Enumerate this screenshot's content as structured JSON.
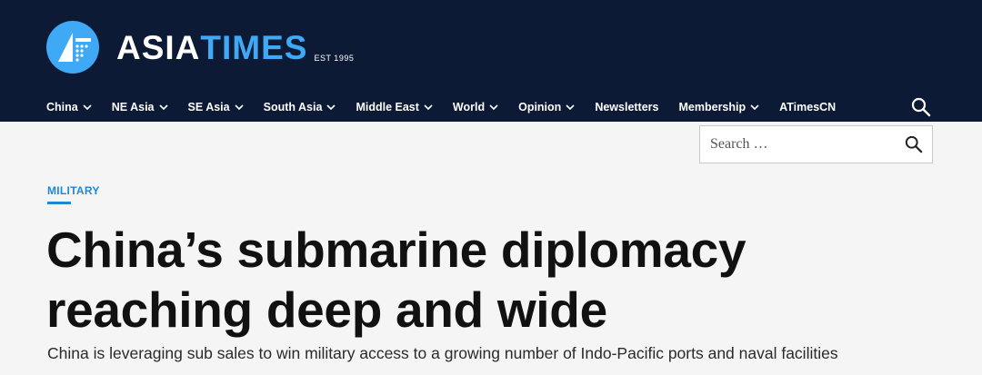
{
  "brand": {
    "name_part1": "ASIA",
    "name_part2": "TIMES",
    "est": "EST 1995",
    "primary_color": "#0c1a35",
    "accent_color": "#3fa9f5"
  },
  "nav": {
    "items": [
      {
        "label": "China",
        "has_dropdown": true
      },
      {
        "label": "NE Asia",
        "has_dropdown": true
      },
      {
        "label": "SE Asia",
        "has_dropdown": true
      },
      {
        "label": "South Asia",
        "has_dropdown": true
      },
      {
        "label": "Middle East",
        "has_dropdown": true
      },
      {
        "label": "World",
        "has_dropdown": true
      },
      {
        "label": "Opinion",
        "has_dropdown": true
      },
      {
        "label": "Newsletters",
        "has_dropdown": false
      },
      {
        "label": "Membership",
        "has_dropdown": true
      },
      {
        "label": "ATimesCN",
        "has_dropdown": false
      }
    ],
    "search_icon": "search-icon"
  },
  "search": {
    "placeholder": "Search …",
    "value": ""
  },
  "article": {
    "category": "MILITARY",
    "category_color": "#1e88d6",
    "headline": "China’s submarine diplomacy reaching deep and wide",
    "subheadline": "China is leveraging sub sales to win military access to a growing number of Indo-Pacific ports and naval facilities"
  }
}
